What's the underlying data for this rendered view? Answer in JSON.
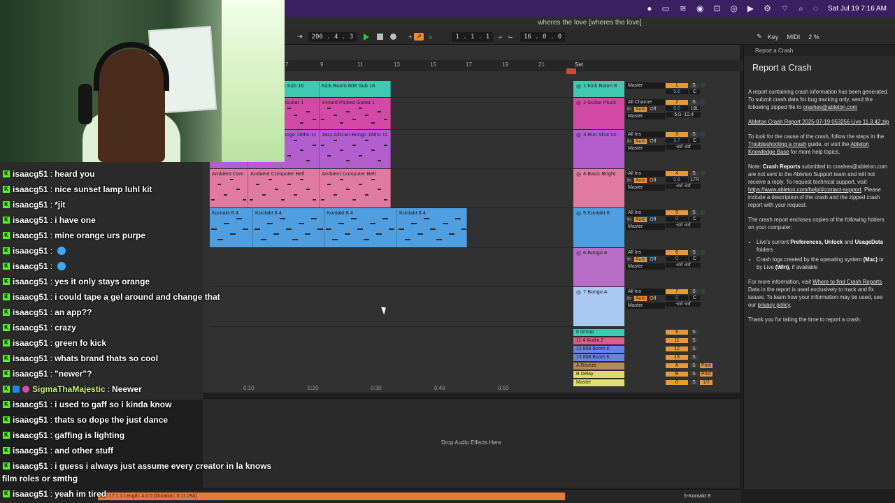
{
  "menubar": {
    "datetime": "Sat Jul 19  7:16 AM"
  },
  "window": {
    "title": "wheres the love  [wheres the love]"
  },
  "transport": {
    "position": "206 .  4 .  3",
    "bar_pos": "1 .  1 .  1",
    "loop_len": "16 .  0 .  0",
    "key_label": "Key",
    "midi_label": "MIDI",
    "cpu": "2 %"
  },
  "ruler": {
    "bars": [
      "7",
      "9",
      "11",
      "13",
      "15",
      "17",
      "19",
      "21"
    ],
    "set_label": "Set"
  },
  "timeline": {
    "marks": [
      "0:10",
      "0:20",
      "0:30",
      "0:40",
      "0:50"
    ]
  },
  "tracks": [
    {
      "name": "1 Kick Boom 8",
      "color": "#3fc9b3",
      "input": "",
      "output": "Master",
      "num": "1",
      "vol": "5.6",
      "pan": "C",
      "clips": [
        "808s Sub 16",
        "Kick Boom 808 Sub 16",
        "Kick Boom 808 Sub 16"
      ]
    },
    {
      "name": "2 Guitar Pluck",
      "color": "#d34aa6",
      "input": "All Channe",
      "output": "Master",
      "num": "2",
      "vol": "6.0",
      "pan": "18L",
      "extra": "-5.0  -12.4",
      "clips": [
        "Guitar 1",
        "3-Hard Picked Guitar 1",
        "3-Hard Picked Guitar 1"
      ]
    },
    {
      "name": "3 Rim Shot 50",
      "color": "#b35ecf",
      "input": "All Ins",
      "output": "Master",
      "num": "3",
      "vol": "3.7",
      "pan": "C",
      "extra": "-inf  -inf",
      "clips": [
        "Bongo 16ths 11",
        "Jazz African Bongo 16ths 11",
        "Jazz African Bongo 16ths 11"
      ]
    },
    {
      "name": "4 Basic Bright",
      "color": "#e07aa0",
      "input": "All Ins",
      "output": "Master",
      "num": "4",
      "vol": "0.6",
      "pan": "17R",
      "extra": "-inf  -inf",
      "clips": [
        "Ambient Com",
        "Ambient Computer Bell",
        "Ambient Computer Bell"
      ]
    },
    {
      "name": "5 Kontakt 8",
      "color": "#4f9ee0",
      "input": "All Ins",
      "output": "Master",
      "num": "5",
      "vol": "0",
      "pan": "C",
      "extra": "-inf  -inf",
      "clips": [
        "Kontakt 8 4",
        "Kontakt 8 4",
        "Kontakt 8 4",
        "Kontakt 8 4"
      ]
    },
    {
      "name": "6 Bongo 8",
      "color": "#b86ec7",
      "input": "All Ins",
      "output": "Master",
      "num": "6",
      "vol": "0",
      "pan": "C",
      "extra": "-inf  -inf",
      "clips": []
    },
    {
      "name": "7 Bongo A",
      "color": "#a9c9f2",
      "input": "All Ins",
      "output": "Master",
      "num": "7",
      "vol": "0",
      "pan": "C",
      "extra": "-inf  -inf",
      "clips": []
    }
  ],
  "small_tracks": [
    {
      "name": "8 Group",
      "color": "#3fc9b3",
      "num": "8",
      "extra": ""
    },
    {
      "name": "11 4-Audio 2",
      "color": "#e05c8a",
      "num": "11",
      "extra": ""
    },
    {
      "name": "12 808 Boom K",
      "color": "#6a82e0",
      "num": "12",
      "extra": ""
    },
    {
      "name": "13 808 Boom K",
      "color": "#6a82e0",
      "num": "13",
      "extra": ""
    },
    {
      "name": "A Reverb",
      "color": "#b38a5c",
      "num": "A",
      "extra": "Post"
    },
    {
      "name": "B Delay",
      "color": "#e0d86a",
      "num": "B",
      "extra": "Post"
    },
    {
      "name": "Master",
      "color": "#e0e07a",
      "num": "0",
      "extra": "1/2"
    }
  ],
  "io_labels": {
    "in": "In",
    "auto": "Auto",
    "off": "Off",
    "solo": "S"
  },
  "device": {
    "drop_hint": "Drop Audio Effects Here"
  },
  "status": {
    "bar_text": "nd: 17.1.1     Length: 4.0.0  (Duration: 0:11:294)",
    "track": "5-Kontakt 8"
  },
  "help": {
    "header": "Report a Crash",
    "title": "Report a Crash",
    "p1": "A report containing crash information has been generated. To submit crash data for bug tracking only, send the following zipped file to",
    "email1": "crashes@ableton.com",
    "report_file": "Ableton Crash Report 2025-07-19 053256 Live 11.3.42.zip",
    "p2a": "To look for the cause of the crash, follow the steps in the",
    "link_guide": "Troubleshooting a crash",
    "p2b": "guide, or visit the",
    "link_kb": "Ableton Knowledge Base",
    "p2c": "for more help topics.",
    "p3a": "Note:",
    "p3b": "Crash Reports",
    "p3c": "submitted to crashes@ableton.com are not sent to the Ableton Support team and will not receive a reply. To request technical support, visit",
    "link_support": "https://www.ableton.com/help/#contact-support",
    "p3d": ". Please include a description of the crash and the zipped crash report with your request.",
    "p4": "The crash report encloses copies of the following folders on your computer:",
    "li1a": "Live's current",
    "li1b": "Preferences, Unlock",
    "li1c": "and",
    "li1d": "UsageData",
    "li1e": "folders",
    "li2a": "Crash logs created by the operating system",
    "li2b": "(Mac)",
    "li2c": "or by Live",
    "li2d": "(Win),",
    "li2e": "if available",
    "p5a": "For more information, visit",
    "link_where": "Where to find Crash Reports",
    "p5b": ". Data in the report is used exclusively to track and fix issues. To learn how your information may be used, see our",
    "link_privacy": "privacy policy",
    "p6": "Thank you for taking the time to report a crash."
  },
  "chat": [
    {
      "user": "isaacg51",
      "text": "heard you"
    },
    {
      "user": "isaacg51",
      "text": "nice sunset lamp luhl kit"
    },
    {
      "user": "isaacg51",
      "text": "*jit"
    },
    {
      "user": "isaacg51",
      "text": "i have one"
    },
    {
      "user": "isaacg51",
      "text": "mine orange urs purpe"
    },
    {
      "user": "isaacg51",
      "text": ""
    },
    {
      "user": "isaacg51",
      "text": ""
    },
    {
      "user": "isaacg51",
      "text": "yes it only stays orange"
    },
    {
      "user": "isaacg51",
      "text": "i could tape a gel around and change that"
    },
    {
      "user": "isaacg51",
      "text": "an app??"
    },
    {
      "user": "isaacg51",
      "text": "crazy"
    },
    {
      "user": "isaacg51",
      "text": "green fo kick"
    },
    {
      "user": "isaacg51",
      "text": "whats brand thats so cool"
    },
    {
      "user": "isaacg51",
      "text": "\"newer\"?"
    },
    {
      "user": "SigmaThaMajestic",
      "text": "Neewer"
    },
    {
      "user": "isaacg51",
      "text": "i used to gaff so i kinda know"
    },
    {
      "user": "isaacg51",
      "text": "thats so dope the just dance"
    },
    {
      "user": "isaacg51",
      "text": "gaffing is lighting"
    },
    {
      "user": "isaacg51",
      "text": "and other stuff"
    },
    {
      "user": "isaacg51",
      "text": "i guess i always just assume every creator in la knows"
    },
    {
      "user": "isaacg51",
      "text": "yeah im tired"
    }
  ],
  "chat_continuation": "film roles or smthg"
}
